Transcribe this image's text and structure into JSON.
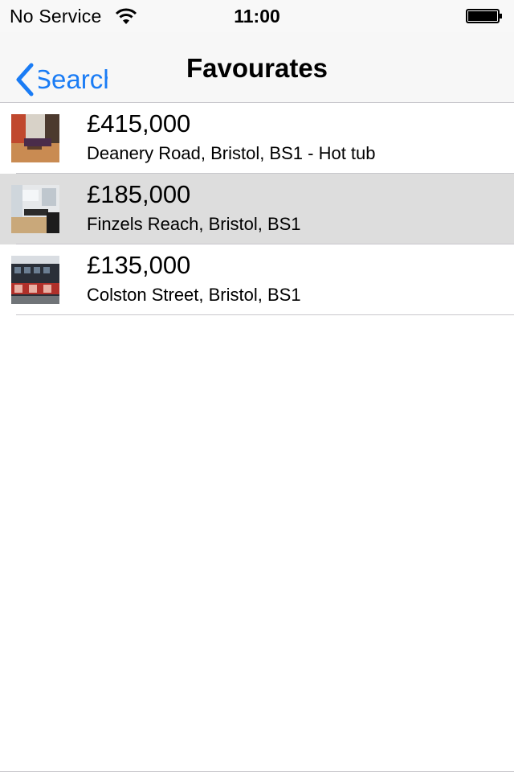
{
  "status_bar": {
    "carrier": "No Service",
    "time": "11:00",
    "wifi_icon": "wifi-icon",
    "battery_icon": "battery-icon"
  },
  "nav": {
    "back_label": "Search",
    "back_icon": "chevron-left-icon",
    "title": "Favourates",
    "accent_color": "#1a7cf5"
  },
  "listings": [
    {
      "price": "£415,000",
      "address": "Deanery Road, Bristol, BS1 - Hot tub",
      "selected": false,
      "thumbnail": "living-room-photo"
    },
    {
      "price": "£185,000",
      "address": "Finzels Reach, Bristol, BS1",
      "selected": true,
      "thumbnail": "office-room-photo"
    },
    {
      "price": "£135,000",
      "address": "Colston Street, Bristol, BS1",
      "selected": false,
      "thumbnail": "building-facade-photo"
    }
  ]
}
